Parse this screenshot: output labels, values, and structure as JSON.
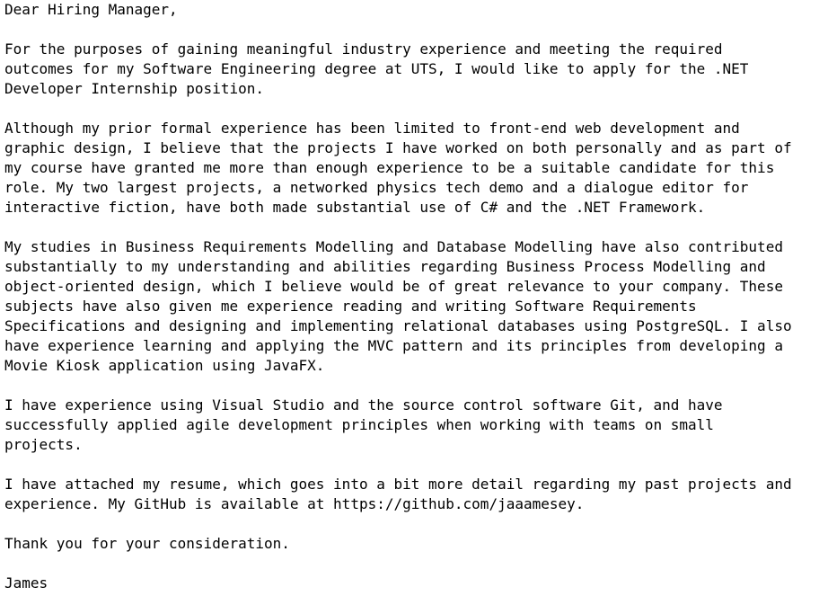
{
  "letter": {
    "salutation": "Dear Hiring Manager,",
    "paragraphs": [
      [
        "For the purposes of gaining meaningful industry experience and meeting the required",
        "outcomes for my Software Engineering degree at UTS, I would like to apply for the .NET",
        "Developer Internship position."
      ],
      [
        "Although my prior formal experience has been limited to front-end web development and",
        "graphic design, I believe that the projects I have worked on both personally and as part of",
        "my course have granted me more than enough experience to be a suitable candidate for this",
        "role. My two largest projects, a networked physics tech demo and a dialogue editor for",
        "interactive fiction, have both made substantial use of C# and the .NET Framework."
      ],
      [
        "My studies in Business Requirements Modelling and Database Modelling have also contributed",
        "substantially to my understanding and abilities regarding Business Process Modelling and",
        "object-oriented design, which I believe would be of great relevance to your company. These",
        "subjects have also given me experience reading and writing Software Requirements",
        "Specifications and designing and implementing relational databases using PostgreSQL. I also",
        "have experience learning and applying the MVC pattern and its principles from developing a",
        "Movie Kiosk application using JavaFX."
      ],
      [
        "I have experience using Visual Studio and the source control software Git, and have",
        "successfully applied agile development principles when working with teams on small",
        "projects."
      ],
      [
        "I have attached my resume, which goes into a bit more detail regarding my past projects and",
        "experience. My GitHub is available at https://github.com/jaaamesey."
      ],
      [
        "Thank you for your consideration."
      ]
    ],
    "signature": "James"
  }
}
